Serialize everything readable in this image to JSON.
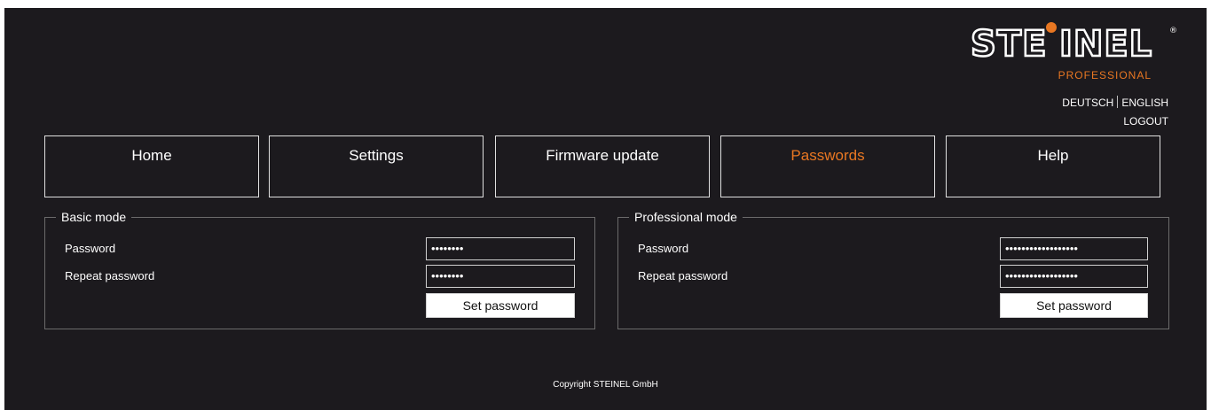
{
  "brand": {
    "logo_text": "STEINEL",
    "logo_sub": "PROFESSIONAL",
    "accent_color": "#e87722"
  },
  "header": {
    "lang_de": "DEUTSCH",
    "lang_en": "ENGLISH",
    "logout": "LOGOUT"
  },
  "nav": {
    "tabs": [
      {
        "label": "Home"
      },
      {
        "label": "Settings"
      },
      {
        "label": "Firmware update"
      },
      {
        "label": "Passwords",
        "active": true
      },
      {
        "label": "Help"
      }
    ]
  },
  "basic": {
    "legend": "Basic mode",
    "password_label": "Password",
    "repeat_label": "Repeat password",
    "password_value": "••••••••",
    "repeat_value": "••••••••",
    "button": "Set password"
  },
  "professional": {
    "legend": "Professional mode",
    "password_label": "Password",
    "repeat_label": "Repeat password",
    "password_value": "••••••••••••••••••",
    "repeat_value": "••••••••••••••••••",
    "button": "Set password"
  },
  "footer": {
    "copyright": "Copyright STEINEL GmbH"
  }
}
